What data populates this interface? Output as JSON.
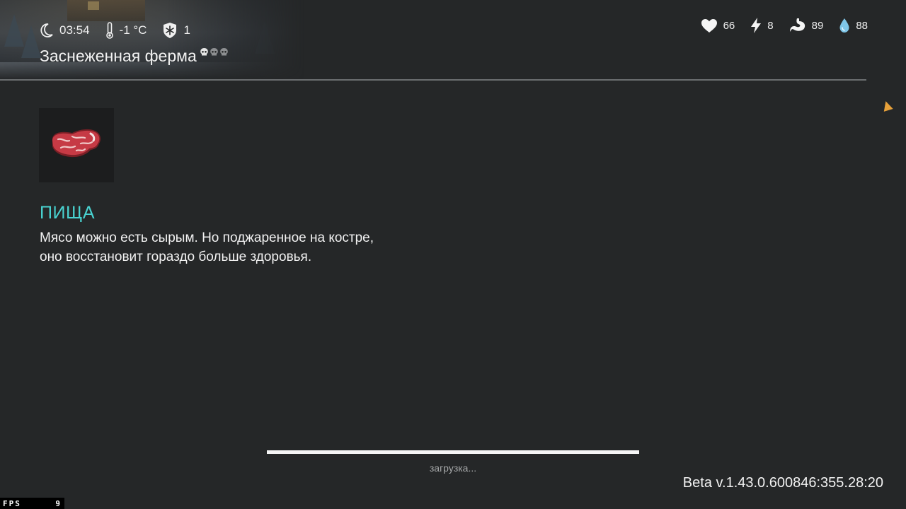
{
  "hud": {
    "time": "03:54",
    "temperature": "-1 °C",
    "frost_level": "1",
    "location": "Заснеженная ферма",
    "difficulty_skulls": [
      "skull-icon",
      "skull-icon",
      "skull-icon"
    ],
    "icons": {
      "time": "moon-icon",
      "temperature": "thermometer-icon",
      "frost": "snowflake-shield-icon"
    }
  },
  "vitals": [
    {
      "icon": "heart-icon",
      "value": "66"
    },
    {
      "icon": "lightning-icon",
      "value": "8"
    },
    {
      "icon": "stomach-icon",
      "value": "89"
    },
    {
      "icon": "water-drop-icon",
      "value": "88"
    }
  ],
  "tip": {
    "item_icon": "raw-steak-icon",
    "category": "ПИЩА",
    "line1": "Мясо можно есть сырым. Но поджаренное на костре,",
    "line2": "оно восстановит гораздо больше здоровья."
  },
  "loading": {
    "label": "загрузка...",
    "progress": 1.0
  },
  "version": "Beta v.1.43.0.600846:355.28:20",
  "fps": {
    "label": "FPS",
    "value": "9"
  },
  "colors": {
    "background": "#252728",
    "accent": "#49d3d1",
    "cursor": "#e7a13a"
  }
}
